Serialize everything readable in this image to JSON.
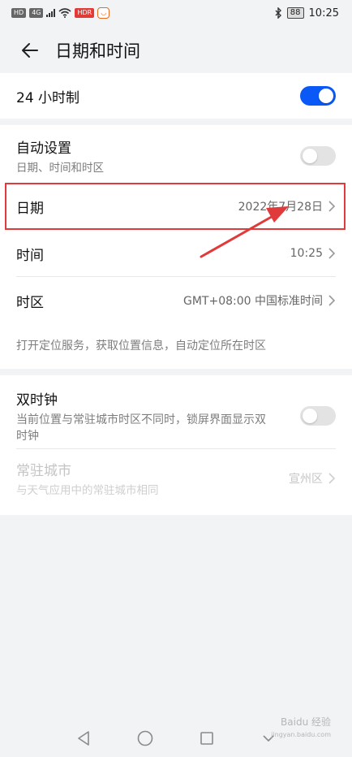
{
  "status_bar": {
    "left_chips": [
      "HD",
      "4G"
    ],
    "app_chip": "HDR",
    "time": "10:25",
    "battery": "88",
    "icons": [
      "bluetooth-icon",
      "wifi-icon",
      "signal-icon",
      "battery-icon"
    ]
  },
  "header": {
    "title": "日期和时间",
    "back_icon": "arrow-left-icon"
  },
  "hour24": {
    "label": "24 小时制",
    "enabled": true
  },
  "auto": {
    "label": "自动设置",
    "sublabel": "日期、时间和时区",
    "enabled": false
  },
  "date": {
    "label": "日期",
    "value": "2022年7月28日"
  },
  "time": {
    "label": "时间",
    "value": "10:25"
  },
  "timezone": {
    "label": "时区",
    "value": "GMT+08:00 中国标准时间"
  },
  "location_hint": "打开定位服务，获取位置信息，自动定位所在时区",
  "dual_clock": {
    "label": "双时钟",
    "sublabel": "当前位置与常驻城市时区不同时，锁屏界面显示双时钟",
    "enabled": false
  },
  "home_city": {
    "label": "常驻城市",
    "sublabel": "与天气应用中的常驻城市相同",
    "value": "宣州区"
  },
  "annotation": {
    "highlight_color": "#e03a3a"
  },
  "colors": {
    "accent": "#0a59f7",
    "background": "#f1f3f5"
  },
  "watermark": {
    "line1": "Baidu 经验",
    "line2": "jingyan.baidu.com"
  }
}
